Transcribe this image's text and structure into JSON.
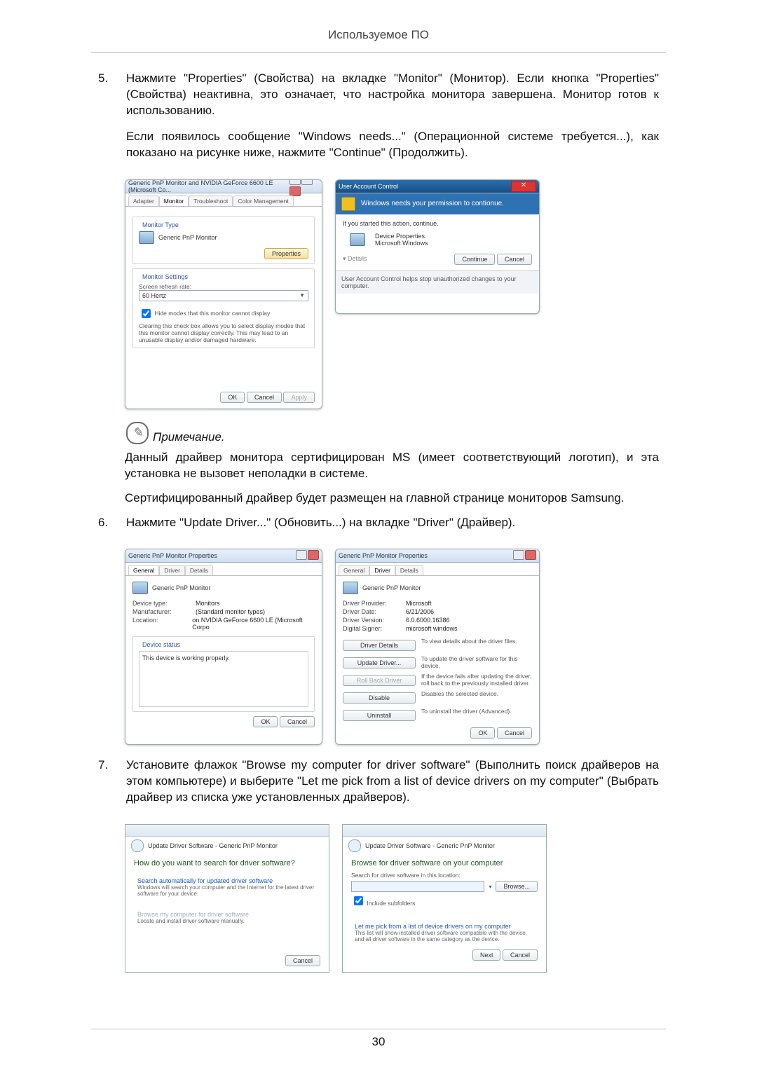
{
  "header": "Используемое ПО",
  "page_number": "30",
  "steps": {
    "s5": {
      "num": "5.",
      "p1": "Нажмите \"Properties\" (Свойства) на вкладке \"Monitor\" (Монитор). Если кнопка \"Properties\" (Свойства) неактивна, это означает, что настройка монитора завершена. Монитор готов к использованию.",
      "p2": "Если появилось сообщение \"Windows needs...\" (Операционной системе требуется...), как показано на рисунке ниже, нажмите \"Continue\" (Продолжить)."
    },
    "s6": {
      "num": "6.",
      "p1": "Нажмите \"Update Driver...\" (Обновить...) на вкладке \"Driver\" (Драйвер)."
    },
    "s7": {
      "num": "7.",
      "p1": "Установите флажок \"Browse my computer for driver software\" (Выполнить поиск драйверов на этом компьютере) и выберите \"Let me pick from a list of device drivers on my computer\" (Выбрать драйвер из списка уже установленных драйверов)."
    }
  },
  "note": {
    "label": "Примечание.",
    "p1": "Данный драйвер монитора сертифицирован MS (имеет соответствующий логотип), и эта установка не вызовет неполадки в системе.",
    "p2": "Сертифицированный драйвер будет размещен на главной странице мониторов Samsung."
  },
  "fig1": {
    "left": {
      "title": "Generic PnP Monitor and NVIDIA GeForce 6600 LE (Microsoft Co...",
      "tabs": [
        "Adapter",
        "Monitor",
        "Troubleshoot",
        "Color Management"
      ],
      "monitor_type_label": "Monitor Type",
      "monitor_name": "Generic PnP Monitor",
      "properties_btn": "Properties",
      "settings_label": "Monitor Settings",
      "refresh_label": "Screen refresh rate:",
      "refresh_value": "60 Hertz",
      "hide_modes": "Hide modes that this monitor cannot display",
      "hide_modes_desc": "Clearing this check box allows you to select display modes that this monitor cannot display correctly. This may lead to an unusable display and/or damaged hardware.",
      "ok": "OK",
      "cancel": "Cancel",
      "apply": "Apply"
    },
    "right": {
      "title": "User Account Control",
      "banner": "Windows needs your permission to contionue.",
      "started": "If you started this action, continue.",
      "item1": "Device Properties",
      "item2": "Microsoft Windows",
      "details": "Details",
      "continue": "Continue",
      "cancel": "Cancel",
      "bottom": "User Account Control helps stop unauthorized changes to your computer."
    }
  },
  "fig2": {
    "left": {
      "title": "Generic PnP Monitor Properties",
      "tabs": [
        "General",
        "Driver",
        "Details"
      ],
      "name": "Generic PnP Monitor",
      "kv": {
        "dt_k": "Device type:",
        "dt_v": "Monitors",
        "mf_k": "Manufacturer:",
        "mf_v": "(Standard monitor types)",
        "lo_k": "Location:",
        "lo_v": "on NVIDIA GeForce 6600 LE (Microsoft Corpo"
      },
      "status_label": "Device status",
      "status_text": "This device is working properly.",
      "ok": "OK",
      "cancel": "Cancel"
    },
    "right": {
      "title": "Generic PnP Monitor Properties",
      "tabs": [
        "General",
        "Driver",
        "Details"
      ],
      "name": "Generic PnP Monitor",
      "kv": {
        "dp_k": "Driver Provider:",
        "dp_v": "Microsoft",
        "dd_k": "Driver Date:",
        "dd_v": "6/21/2006",
        "dv_k": "Driver Version:",
        "dv_v": "6.0.6000.16386",
        "ds_k": "Digital Signer:",
        "ds_v": "microsoft windows"
      },
      "btn_details": "Driver Details",
      "btn_details_d": "To view details about the driver files.",
      "btn_update": "Update Driver...",
      "btn_update_d": "To update the driver software for this device.",
      "btn_rollback": "Roll Back Driver",
      "btn_rollback_d": "If the device fails after updating the driver, roll back to the previously installed driver.",
      "btn_disable": "Disable",
      "btn_disable_d": "Disables the selected device.",
      "btn_uninstall": "Uninstall",
      "btn_uninstall_d": "To uninstall the driver (Advanced).",
      "ok": "OK",
      "cancel": "Cancel"
    }
  },
  "fig3": {
    "left": {
      "bread": "Update Driver Software - Generic PnP Monitor",
      "heading": "How do you want to search for driver software?",
      "opt1_t": "Search automatically for updated driver software",
      "opt1_d": "Windows will search your computer and the Internet for the latest driver software for your device.",
      "opt2_t": "Browse my computer for driver software",
      "opt2_d": "Locate and install driver software manually.",
      "cancel": "Cancel"
    },
    "right": {
      "bread": "Update Driver Software - Generic PnP Monitor",
      "heading": "Browse for driver software on your computer",
      "search_label": "Search for driver software in this location:",
      "browse": "Browse...",
      "include": "Include subfolders",
      "opt_t": "Let me pick from a list of device drivers on my computer",
      "opt_d": "This list will show installed driver software compatible with the device, and all driver software in the same category as the device.",
      "next": "Next",
      "cancel": "Cancel"
    }
  }
}
